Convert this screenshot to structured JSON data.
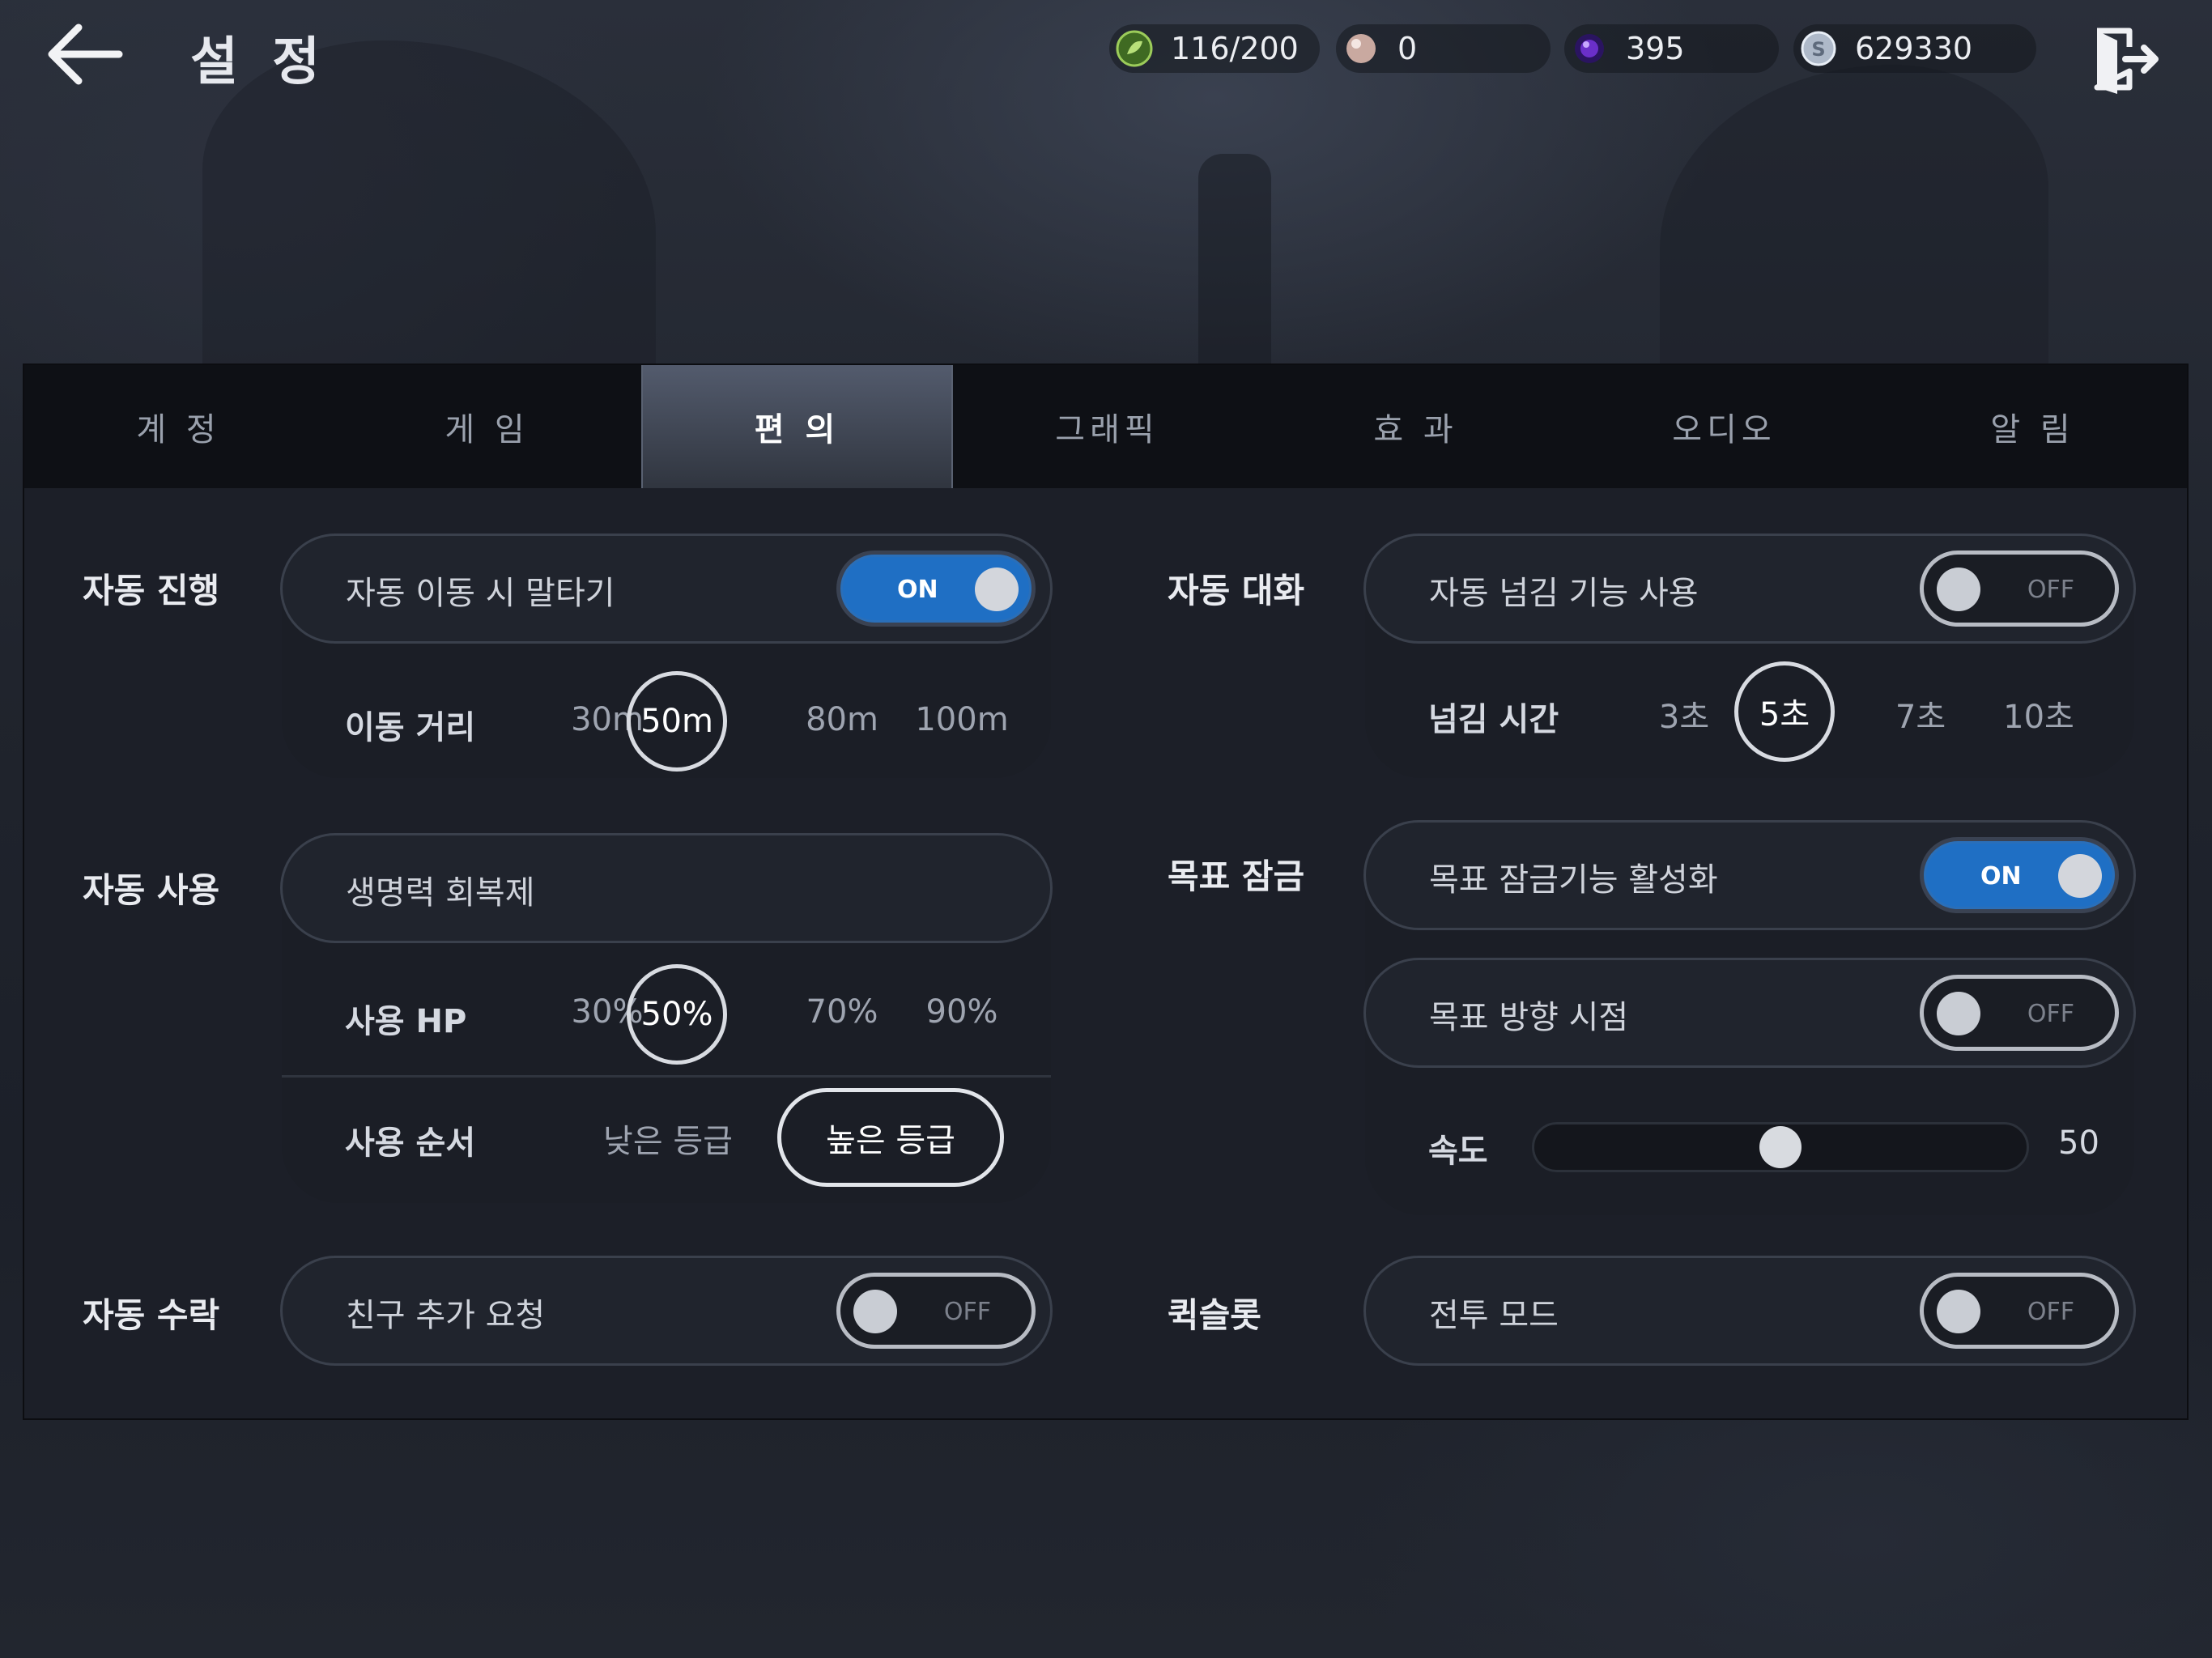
{
  "header": {
    "title": "설 정",
    "back_icon": "back-arrow-icon",
    "exit_icon": "exit-door-icon"
  },
  "currencies": [
    {
      "name": "stamina",
      "icon": "leaf-emblem-icon",
      "value": "116/200",
      "color": "#7fbf3f"
    },
    {
      "name": "pearl",
      "icon": "pearl-icon",
      "value": "0",
      "color": "#d9b8b0"
    },
    {
      "name": "gem",
      "icon": "purple-gem-icon",
      "value": "395",
      "color": "#6a2fc9"
    },
    {
      "name": "silver",
      "icon": "silver-coin-icon",
      "value": "629330",
      "color": "#cfd8e6"
    }
  ],
  "tabs": [
    {
      "label": "계 정",
      "active": false
    },
    {
      "label": "게 임",
      "active": false
    },
    {
      "label": "편 의",
      "active": true
    },
    {
      "label": "그래픽",
      "active": false
    },
    {
      "label": "효 과",
      "active": false
    },
    {
      "label": "오디오",
      "active": false
    },
    {
      "label": "알 림",
      "active": false
    }
  ],
  "left": {
    "auto_progress": {
      "label": "자동 진행",
      "mount_label": "자동 이동 시 말타기",
      "mount_toggle": "ON",
      "distance_label": "이동 거리",
      "distance_options": [
        "30m",
        "50m",
        "80m",
        "100m"
      ],
      "distance_selected": "50m"
    },
    "auto_use": {
      "label": "자동 사용",
      "item_label": "생명력 회복제",
      "hp_label": "사용 HP",
      "hp_options": [
        "30%",
        "50%",
        "70%",
        "90%"
      ],
      "hp_selected": "50%",
      "order_label": "사용 순서",
      "order_low": "낮은 등급",
      "order_high": "높은 등급"
    },
    "auto_accept": {
      "label": "자동 수락",
      "friend_label": "친구 추가 요청",
      "friend_toggle": "OFF"
    }
  },
  "right": {
    "auto_dialog": {
      "label": "자동 대화",
      "skip_label": "자동 넘김 기능 사용",
      "skip_toggle": "OFF",
      "time_label": "넘김 시간",
      "time_options": [
        "3초",
        "5초",
        "7초",
        "10초"
      ],
      "time_selected": "5초"
    },
    "target_lock": {
      "label": "목표 잠금",
      "lock_label": "목표 잠금기능 활성화",
      "lock_toggle": "ON",
      "view_label": "목표 방향 시점",
      "view_toggle": "OFF",
      "speed_label": "속도",
      "speed_value": "50",
      "speed_fraction": 0.5
    },
    "quick_slot": {
      "label": "퀵슬롯",
      "battle_label": "전투 모드",
      "battle_toggle": "OFF"
    }
  }
}
